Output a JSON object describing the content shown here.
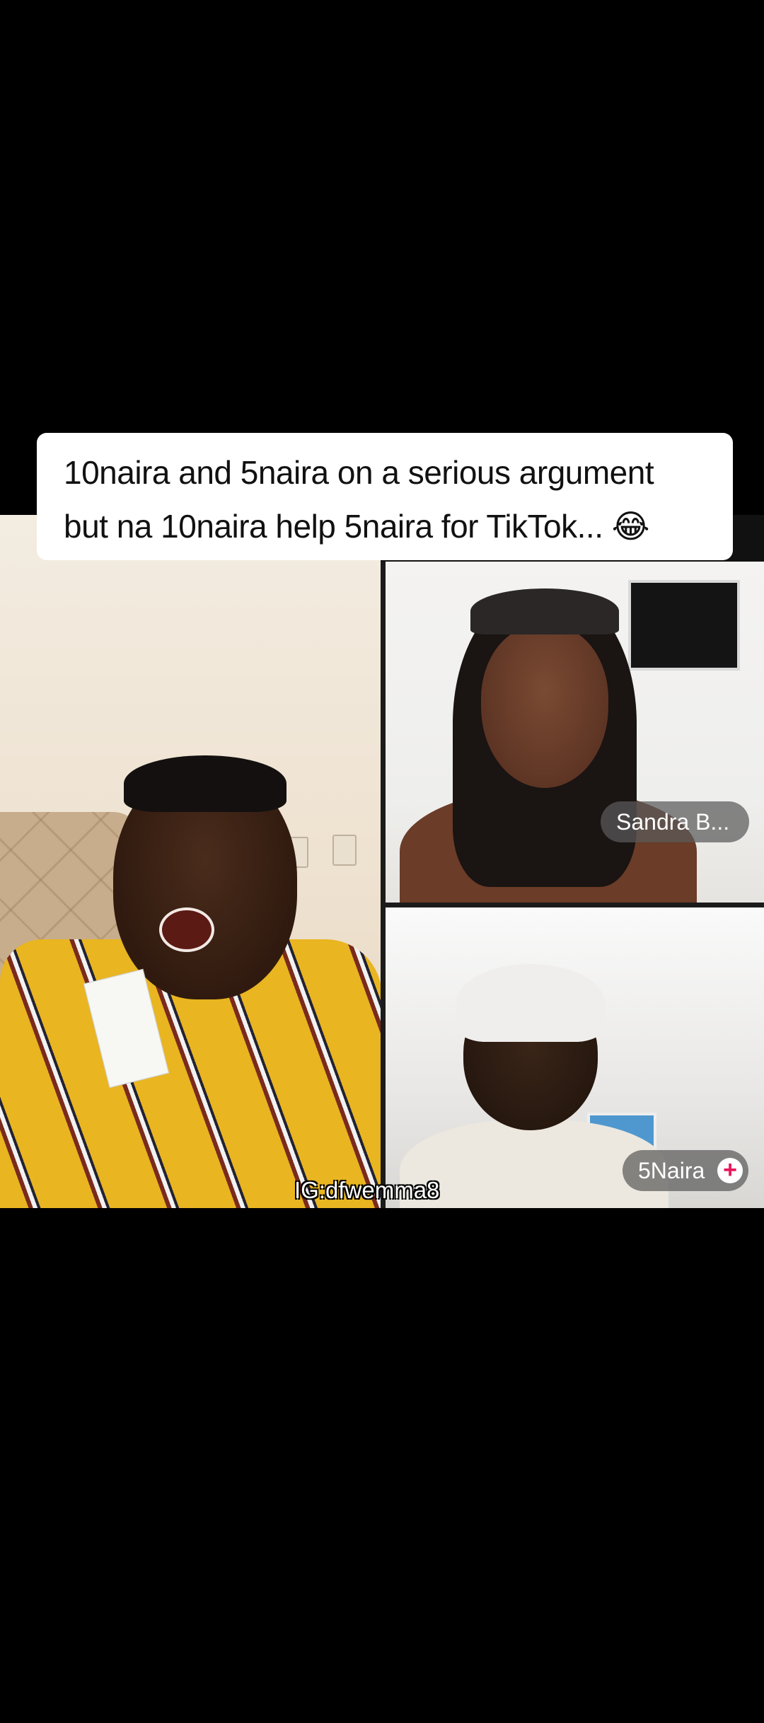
{
  "caption": {
    "line1": "10naira and 5naira on a serious argument",
    "line2": "but na 10naira help 5naira for TikTok... 😂"
  },
  "tiles": {
    "top_right_name": "Sandra B...",
    "bottom_right_name": "5Naira",
    "bottom_right_icon": "plus-icon"
  },
  "watermark": "IG:dfwemma8",
  "colors": {
    "background": "#000000",
    "caption_bg": "#ffffff",
    "tag_bg": "#5a5a5a",
    "plus_accent": "#e8165a"
  }
}
